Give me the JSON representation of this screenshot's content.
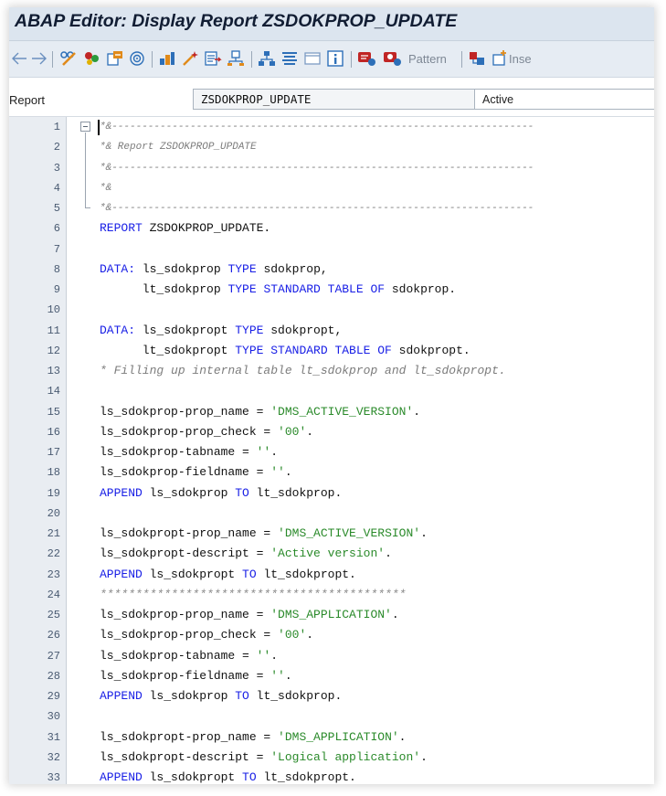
{
  "window": {
    "title": "ABAP Editor: Display Report ZSDOKPROP_UPDATE"
  },
  "toolbar": {
    "icons": [
      "back-arrow-icon",
      "forward-arrow-icon",
      "display-change-icon",
      "activate-icon",
      "check-icon",
      "where-used-icon",
      "object-list-icon",
      "magic-wand-icon",
      "navigation-icon",
      "hierarchy-icon",
      "pretty-printer-icon",
      "fullscreen-icon",
      "info-icon",
      "breakpoint-icon",
      "external-breakpoint-icon",
      "insert-icon"
    ],
    "pattern_label": "Pattern",
    "insert_label": "Inse",
    "colors": {
      "background": "#e6ecf3",
      "accent_blue": "#2d6fb8",
      "icon_red": "#c02525",
      "icon_green": "#2c9a3b",
      "icon_orange": "#e08a1a"
    }
  },
  "report": {
    "label": "Report",
    "name": "ZSDOKPROP_UPDATE",
    "status": "Active"
  },
  "editor": {
    "colors": {
      "keyword": "#1a20e6",
      "text": "#111111",
      "comment": "#7c7c7c",
      "string": "#2a8a2a",
      "gutter": "#e9edf2"
    },
    "lines": [
      {
        "n": "1",
        "segs": [
          [
            "c",
            "*&----------------------------------------------------------------------"
          ]
        ]
      },
      {
        "n": "2",
        "segs": [
          [
            "c",
            "*& Report ZSDOKPROP_UPDATE"
          ]
        ]
      },
      {
        "n": "3",
        "segs": [
          [
            "c",
            "*&----------------------------------------------------------------------"
          ]
        ]
      },
      {
        "n": "4",
        "segs": [
          [
            "c",
            "*&"
          ]
        ]
      },
      {
        "n": "5",
        "segs": [
          [
            "c",
            "*&----------------------------------------------------------------------"
          ]
        ]
      },
      {
        "n": "6",
        "segs": [
          [
            "k",
            "REPORT"
          ],
          [
            "t",
            " ZSDOKPROP_UPDATE."
          ]
        ]
      },
      {
        "n": "7",
        "segs": []
      },
      {
        "n": "8",
        "segs": [
          [
            "k",
            "DATA:"
          ],
          [
            "t",
            " ls_sdokprop "
          ],
          [
            "k",
            "TYPE"
          ],
          [
            "t",
            " sdokprop,"
          ]
        ]
      },
      {
        "n": "9",
        "segs": [
          [
            "t",
            "      lt_sdokprop "
          ],
          [
            "k",
            "TYPE STANDARD TABLE OF"
          ],
          [
            "t",
            " sdokprop."
          ]
        ]
      },
      {
        "n": "10",
        "segs": []
      },
      {
        "n": "11",
        "segs": [
          [
            "k",
            "DATA:"
          ],
          [
            "t",
            " ls_sdokpropt "
          ],
          [
            "k",
            "TYPE"
          ],
          [
            "t",
            " sdokpropt,"
          ]
        ]
      },
      {
        "n": "12",
        "segs": [
          [
            "t",
            "      lt_sdokpropt "
          ],
          [
            "k",
            "TYPE STANDARD TABLE OF"
          ],
          [
            "t",
            " sdokpropt."
          ]
        ]
      },
      {
        "n": "13",
        "segs": [
          [
            "c",
            "* Filling up internal table lt_sdokprop and lt_sdokpropt."
          ]
        ]
      },
      {
        "n": "14",
        "segs": []
      },
      {
        "n": "15",
        "segs": [
          [
            "t",
            "ls_sdokprop-prop_name = "
          ],
          [
            "s",
            "'DMS_ACTIVE_VERSION'"
          ],
          [
            "t",
            "."
          ]
        ]
      },
      {
        "n": "16",
        "segs": [
          [
            "t",
            "ls_sdokprop-prop_check = "
          ],
          [
            "s",
            "'00'"
          ],
          [
            "t",
            "."
          ]
        ]
      },
      {
        "n": "17",
        "segs": [
          [
            "t",
            "ls_sdokprop-tabname = "
          ],
          [
            "s",
            "''"
          ],
          [
            "t",
            "."
          ]
        ]
      },
      {
        "n": "18",
        "segs": [
          [
            "t",
            "ls_sdokprop-fieldname = "
          ],
          [
            "s",
            "''"
          ],
          [
            "t",
            "."
          ]
        ]
      },
      {
        "n": "19",
        "segs": [
          [
            "k",
            "APPEND"
          ],
          [
            "t",
            " ls_sdokprop "
          ],
          [
            "k",
            "TO"
          ],
          [
            "t",
            " lt_sdokprop."
          ]
        ]
      },
      {
        "n": "20",
        "segs": []
      },
      {
        "n": "21",
        "segs": [
          [
            "t",
            "ls_sdokpropt-prop_name = "
          ],
          [
            "s",
            "'DMS_ACTIVE_VERSION'"
          ],
          [
            "t",
            "."
          ]
        ]
      },
      {
        "n": "22",
        "segs": [
          [
            "t",
            "ls_sdokpropt-descript = "
          ],
          [
            "s",
            "'Active version'"
          ],
          [
            "t",
            "."
          ]
        ]
      },
      {
        "n": "23",
        "segs": [
          [
            "k",
            "APPEND"
          ],
          [
            "t",
            " ls_sdokpropt "
          ],
          [
            "k",
            "TO"
          ],
          [
            "t",
            " lt_sdokpropt."
          ]
        ]
      },
      {
        "n": "24",
        "segs": [
          [
            "x",
            "*******************************************"
          ]
        ]
      },
      {
        "n": "25",
        "segs": [
          [
            "t",
            "ls_sdokprop-prop_name = "
          ],
          [
            "s",
            "'DMS_APPLICATION'"
          ],
          [
            "t",
            "."
          ]
        ]
      },
      {
        "n": "26",
        "segs": [
          [
            "t",
            "ls_sdokprop-prop_check = "
          ],
          [
            "s",
            "'00'"
          ],
          [
            "t",
            "."
          ]
        ]
      },
      {
        "n": "27",
        "segs": [
          [
            "t",
            "ls_sdokprop-tabname = "
          ],
          [
            "s",
            "''"
          ],
          [
            "t",
            "."
          ]
        ]
      },
      {
        "n": "28",
        "segs": [
          [
            "t",
            "ls_sdokprop-fieldname = "
          ],
          [
            "s",
            "''"
          ],
          [
            "t",
            "."
          ]
        ]
      },
      {
        "n": "29",
        "segs": [
          [
            "k",
            "APPEND"
          ],
          [
            "t",
            " ls_sdokprop "
          ],
          [
            "k",
            "TO"
          ],
          [
            "t",
            " lt_sdokprop."
          ]
        ]
      },
      {
        "n": "30",
        "segs": []
      },
      {
        "n": "31",
        "segs": [
          [
            "t",
            "ls_sdokpropt-prop_name = "
          ],
          [
            "s",
            "'DMS_APPLICATION'"
          ],
          [
            "t",
            "."
          ]
        ]
      },
      {
        "n": "32",
        "segs": [
          [
            "t",
            "ls_sdokpropt-descript = "
          ],
          [
            "s",
            "'Logical application'"
          ],
          [
            "t",
            "."
          ]
        ]
      },
      {
        "n": "33",
        "segs": [
          [
            "k",
            "APPEND"
          ],
          [
            "t",
            " ls_sdokpropt "
          ],
          [
            "k",
            "TO"
          ],
          [
            "t",
            " lt_sdokpropt."
          ]
        ]
      }
    ]
  }
}
